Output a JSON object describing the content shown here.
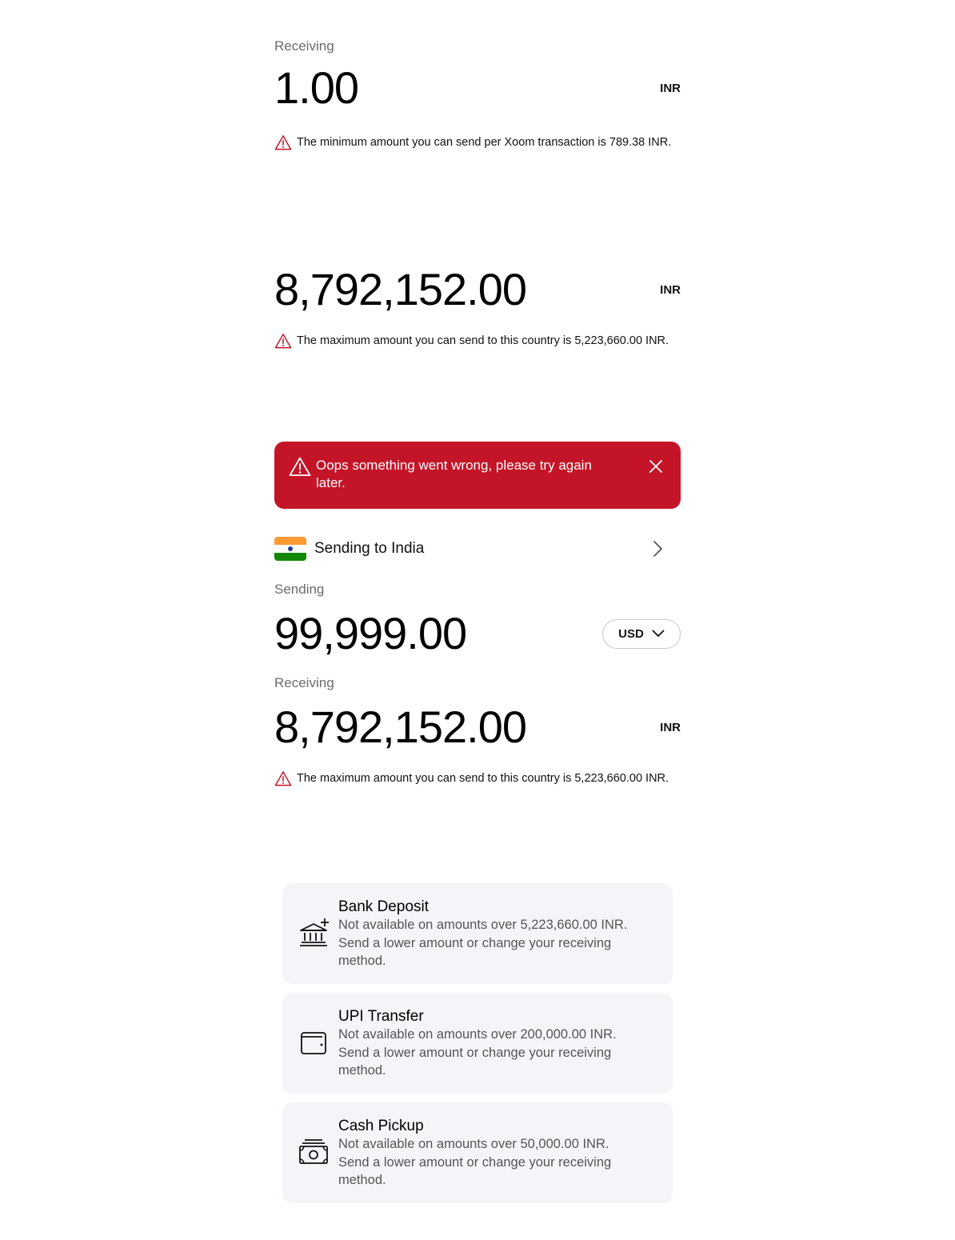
{
  "section1": {
    "label": "Receiving",
    "amount": "1.00",
    "currency": "INR",
    "warning": "The minimum amount you can send per Xoom transaction is 789.38 INR."
  },
  "section2": {
    "amount": "8,792,152.00",
    "currency": "INR",
    "warning": "The maximum amount you can send to this country is 5,223,660.00 INR."
  },
  "error_banner": {
    "message": "Oops something went wrong, please try again later.",
    "color": "#c41428"
  },
  "destination": {
    "label": "Sending to India",
    "flag_colors": [
      "#ff9933",
      "#ffffff",
      "#138808"
    ]
  },
  "sending": {
    "label": "Sending",
    "amount": "99,999.00",
    "currency_select": "USD"
  },
  "receiving": {
    "label": "Receiving",
    "amount": "8,792,152.00",
    "currency": "INR",
    "warning": "The maximum amount you can send to this country is 5,223,660.00 INR."
  },
  "methods": [
    {
      "icon": "bank-icon",
      "title": "Bank Deposit",
      "description": "Not available on amounts over 5,223,660.00 INR. Send a lower amount or change your receiving method."
    },
    {
      "icon": "wallet-icon",
      "title": "UPI Transfer",
      "description": "Not available on amounts over 200,000.00 INR. Send a lower amount or change your receiving method."
    },
    {
      "icon": "cash-icon",
      "title": "Cash Pickup",
      "description": "Not available on amounts over 50,000.00 INR. Send a lower amount or change your receiving method."
    }
  ],
  "colors": {
    "warning_icon": "#c41428",
    "method_bg": "#f4f5f9",
    "muted_text": "#6b6b6b"
  }
}
